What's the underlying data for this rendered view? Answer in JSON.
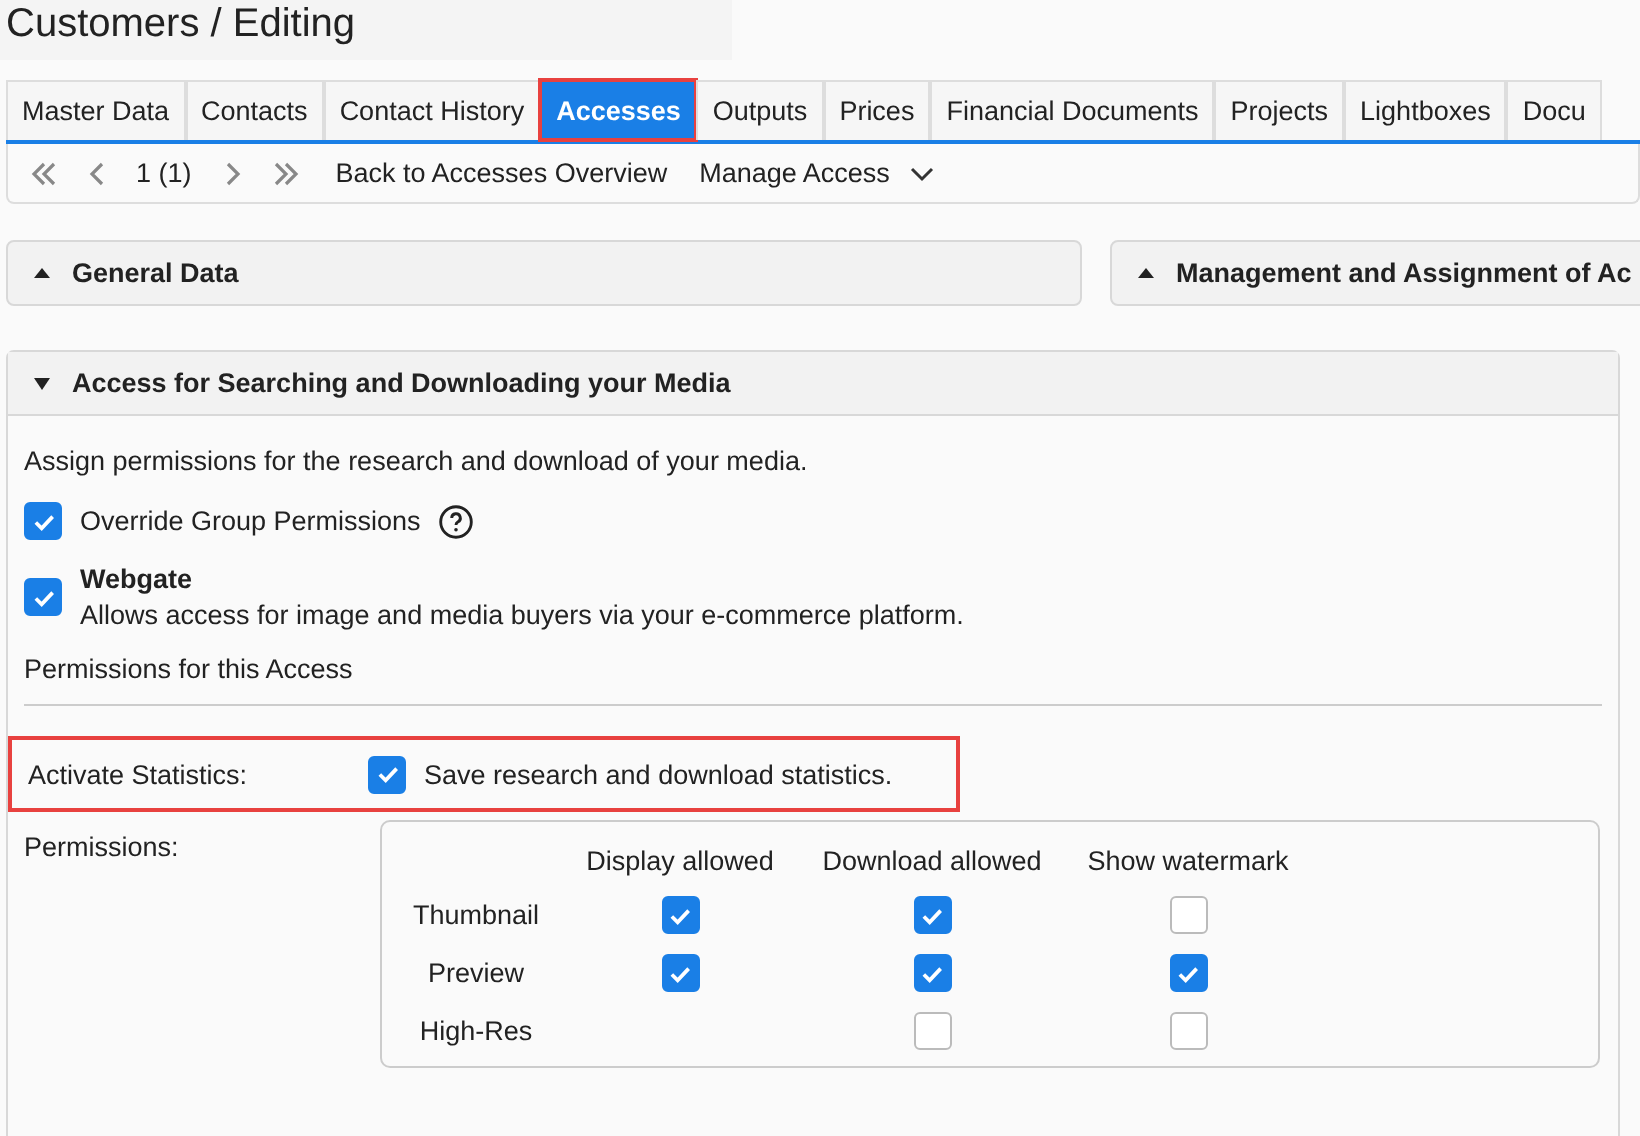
{
  "page_title": "Customers / Editing",
  "tabs": [
    {
      "label": "Master Data",
      "selected": false,
      "highlighted": false
    },
    {
      "label": "Contacts",
      "selected": false,
      "highlighted": false
    },
    {
      "label": "Contact History",
      "selected": false,
      "highlighted": false
    },
    {
      "label": "Accesses",
      "selected": true,
      "highlighted": true
    },
    {
      "label": "Outputs",
      "selected": false,
      "highlighted": false
    },
    {
      "label": "Prices",
      "selected": false,
      "highlighted": false
    },
    {
      "label": "Financial Documents",
      "selected": false,
      "highlighted": false
    },
    {
      "label": "Projects",
      "selected": false,
      "highlighted": false
    },
    {
      "label": "Lightboxes",
      "selected": false,
      "highlighted": false
    },
    {
      "label": "Docu",
      "selected": false,
      "highlighted": false
    }
  ],
  "toolbar": {
    "record_position": "1 (1)",
    "back_link": "Back to Accesses Overview",
    "manage_menu": "Manage Access"
  },
  "collapsed_panels": [
    {
      "title": "General Data",
      "expanded": false
    },
    {
      "title": "Management and Assignment of Ac",
      "expanded": false
    }
  ],
  "section": {
    "title": "Access for Searching and Downloading your Media",
    "expanded": true,
    "intro": "Assign permissions for the research and download of your media.",
    "override": {
      "label": "Override Group Permissions",
      "checked": true
    },
    "webgate": {
      "title": "Webgate",
      "description": "Allows access for image and media buyers via your e-commerce platform.",
      "checked": true
    },
    "permissions_heading": "Permissions for this Access",
    "statistics": {
      "label": "Activate Statistics:",
      "option": "Save research and download statistics.",
      "checked": true,
      "highlighted": true
    },
    "permissions": {
      "label": "Permissions:",
      "columns": [
        "Display allowed",
        "Download allowed",
        "Show watermark"
      ],
      "rows": [
        {
          "name": "Thumbnail",
          "cells": [
            {
              "checked": true
            },
            {
              "checked": true
            },
            {
              "checked": false
            }
          ]
        },
        {
          "name": "Preview",
          "cells": [
            {
              "checked": true
            },
            {
              "checked": true
            },
            {
              "checked": true
            }
          ]
        },
        {
          "name": "High-Res",
          "cells": [
            null,
            {
              "checked": false
            },
            {
              "checked": false
            }
          ]
        }
      ]
    }
  }
}
